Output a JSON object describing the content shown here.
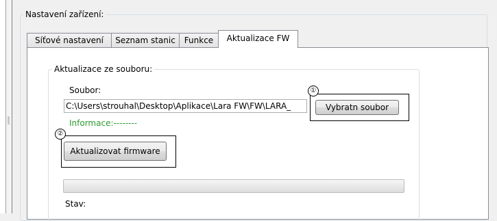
{
  "section_title": "Nastavení zařízení:",
  "tabs": [
    {
      "label": "Síťové nastavení",
      "active": false
    },
    {
      "label": "Seznam stanic",
      "active": false
    },
    {
      "label": "Funkce",
      "active": false
    },
    {
      "label": "Aktualizace FW",
      "active": true
    }
  ],
  "update_group": {
    "title": "Aktualizace ze souboru:",
    "file_label": "Soubor:",
    "file_value": "C:\\Users\\strouhal\\Desktop\\Aplikace\\Lara FW\\FW\\LARA_",
    "select_button": "Vybratn soubor",
    "info_text": "Informace:--------",
    "update_button": "Aktualizovat firmware",
    "progress": 0,
    "status_label": "Stav:"
  },
  "callouts": {
    "one": "①",
    "two": "②"
  }
}
